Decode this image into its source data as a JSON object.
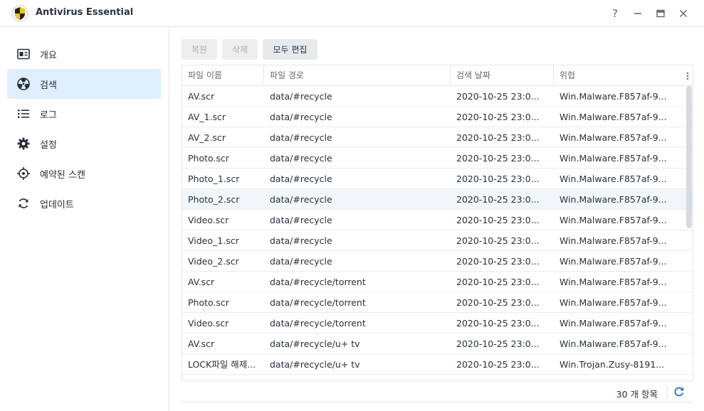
{
  "app": {
    "title": "Antivirus Essential"
  },
  "window_controls": {
    "help": "?",
    "minimize": "minimize",
    "maximize": "maximize",
    "close": "close"
  },
  "sidebar": {
    "items": [
      {
        "label": "개요",
        "icon": "overview-icon"
      },
      {
        "label": "검색",
        "icon": "radiation-icon",
        "active": true
      },
      {
        "label": "로그",
        "icon": "list-icon"
      },
      {
        "label": "설정",
        "icon": "gear-icon"
      },
      {
        "label": "예약된 스캔",
        "icon": "target-icon"
      },
      {
        "label": "업데이트",
        "icon": "refresh-icon"
      }
    ]
  },
  "toolbar": {
    "restore_label": "복원",
    "delete_label": "삭제",
    "edit_all_label": "모두 편집"
  },
  "table": {
    "columns": [
      "파일 이름",
      "파일 경로",
      "검색 날짜",
      "위협"
    ],
    "rows": [
      [
        "AV.scr",
        "data/#recycle",
        "2020-10-25 23:0...",
        "Win.Malware.F857af-9..."
      ],
      [
        "AV_1.scr",
        "data/#recycle",
        "2020-10-25 23:0...",
        "Win.Malware.F857af-9..."
      ],
      [
        "AV_2.scr",
        "data/#recycle",
        "2020-10-25 23:0...",
        "Win.Malware.F857af-9..."
      ],
      [
        "Photo.scr",
        "data/#recycle",
        "2020-10-25 23:0...",
        "Win.Malware.F857af-9..."
      ],
      [
        "Photo_1.scr",
        "data/#recycle",
        "2020-10-25 23:0...",
        "Win.Malware.F857af-9..."
      ],
      [
        "Photo_2.scr",
        "data/#recycle",
        "2020-10-25 23:0...",
        "Win.Malware.F857af-9..."
      ],
      [
        "Video.scr",
        "data/#recycle",
        "2020-10-25 23:0...",
        "Win.Malware.F857af-9..."
      ],
      [
        "Video_1.scr",
        "data/#recycle",
        "2020-10-25 23:0...",
        "Win.Malware.F857af-9..."
      ],
      [
        "Video_2.scr",
        "data/#recycle",
        "2020-10-25 23:0...",
        "Win.Malware.F857af-9..."
      ],
      [
        "AV.scr",
        "data/#recycle/torrent",
        "2020-10-25 23:0...",
        "Win.Malware.F857af-9..."
      ],
      [
        "Photo.scr",
        "data/#recycle/torrent",
        "2020-10-25 23:0...",
        "Win.Malware.F857af-9..."
      ],
      [
        "Video.scr",
        "data/#recycle/torrent",
        "2020-10-25 23:0...",
        "Win.Malware.F857af-9..."
      ],
      [
        "AV.scr",
        "data/#recycle/u+ tv",
        "2020-10-25 23:0...",
        "Win.Malware.F857af-9..."
      ],
      [
        "LOCK파일 해제...",
        "data/#recycle/u+ tv",
        "2020-10-25 23:0...",
        "Win.Trojan.Zusy-8191..."
      ]
    ],
    "highlighted_row": 5
  },
  "footer": {
    "count_text": "30 개 항목"
  },
  "colors": {
    "accent": "#1d6fd1",
    "active_nav": "#dfeefc",
    "logo_yellow": "#f5c518"
  }
}
